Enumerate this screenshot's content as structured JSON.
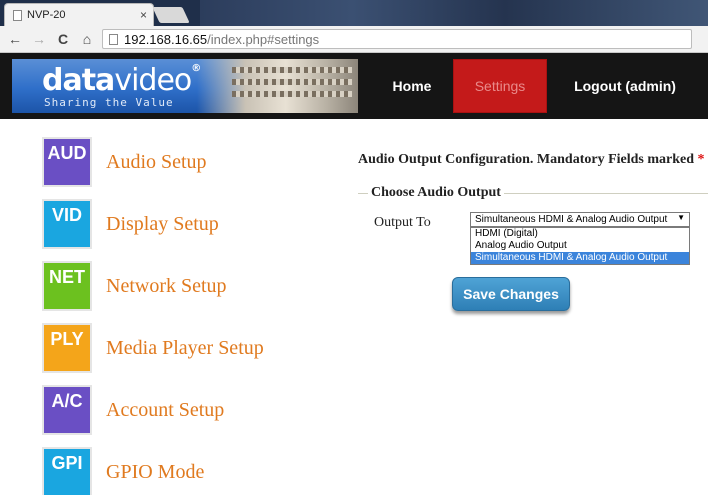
{
  "browser": {
    "tab_title": "NVP-20",
    "tab_close": "×",
    "url_host": "192.168.16.65",
    "url_path": "/index.php#settings",
    "back_glyph": "←",
    "forward_glyph": "→",
    "reload_glyph": "C",
    "home_glyph": "⌂"
  },
  "header": {
    "logo_word_bold": "data",
    "logo_word_light": "video",
    "logo_reg": "®",
    "logo_tagline": "Sharing the Value",
    "nav": {
      "home": "Home",
      "settings": "Settings",
      "logout": "Logout (admin)"
    }
  },
  "sidebar": {
    "items": [
      {
        "icon": "AUD",
        "label": "Audio Setup",
        "color": "#6a4fc4"
      },
      {
        "icon": "VID",
        "label": "Display Setup",
        "color": "#1aa6e0"
      },
      {
        "icon": "NET",
        "label": "Network Setup",
        "color": "#6cc11f"
      },
      {
        "icon": "PLY",
        "label": "Media Player Setup",
        "color": "#f4a51a"
      },
      {
        "icon": "A/C",
        "label": "Account Setup",
        "color": "#6a4fc4"
      },
      {
        "icon": "GPI",
        "label": "GPIO Mode",
        "color": "#1aa6e0"
      }
    ]
  },
  "main": {
    "title": "Audio Output Configuration. Mandatory Fields marked",
    "required_mark": "*",
    "legend": "Choose Audio Output",
    "output_label": "Output To",
    "select_value": "Simultaneous HDMI & Analog Audio Output",
    "select_arrow": "▼",
    "options": [
      "HDMI (Digital)",
      "Analog Audio Output",
      "Simultaneous HDMI & Analog Audio Output"
    ],
    "save_label": "Save Changes"
  }
}
